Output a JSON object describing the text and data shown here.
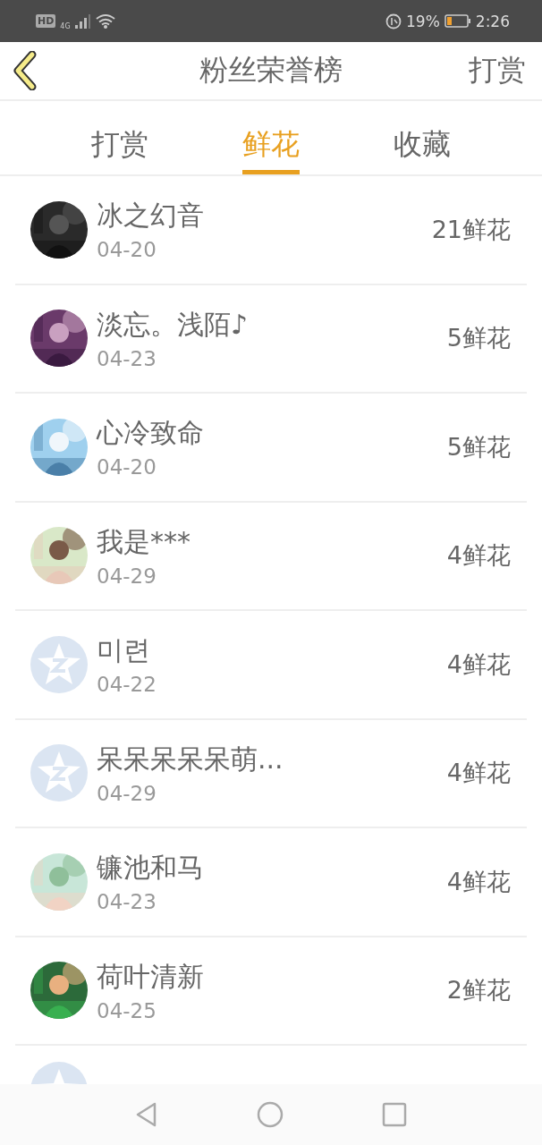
{
  "status_bar": {
    "hd": "HD",
    "network": "4G",
    "battery_percent": "19%",
    "time": "2:26"
  },
  "header": {
    "title": "粉丝荣誉榜",
    "action": "打赏"
  },
  "tabs": [
    {
      "label": "打赏",
      "selected": false
    },
    {
      "label": "鲜花",
      "selected": true
    },
    {
      "label": "收藏",
      "selected": false
    }
  ],
  "fans": [
    {
      "name": "冰之幻音",
      "date": "04-20",
      "amount": "21鲜花"
    },
    {
      "name": "淡忘。浅陌♪",
      "date": "04-23",
      "amount": "5鲜花"
    },
    {
      "name": "心冷致命",
      "date": "04-20",
      "amount": "5鲜花"
    },
    {
      "name": "我是***",
      "date": "04-29",
      "amount": "4鲜花"
    },
    {
      "avatar": {
        "kind": "default"
      },
      "name": "미련",
      "date": "04-22",
      "amount": "4鲜花"
    },
    {
      "avatar": {
        "kind": "default"
      },
      "name": "呆呆呆呆呆萌...",
      "date": "04-29",
      "amount": "4鲜花"
    },
    {
      "name": "镰池和马",
      "date": "04-23",
      "amount": "4鲜花"
    },
    {
      "name": "荷叶清新",
      "date": "04-25",
      "amount": "2鲜花"
    },
    {
      "avatar": {
        "kind": "default"
      }
    }
  ]
}
